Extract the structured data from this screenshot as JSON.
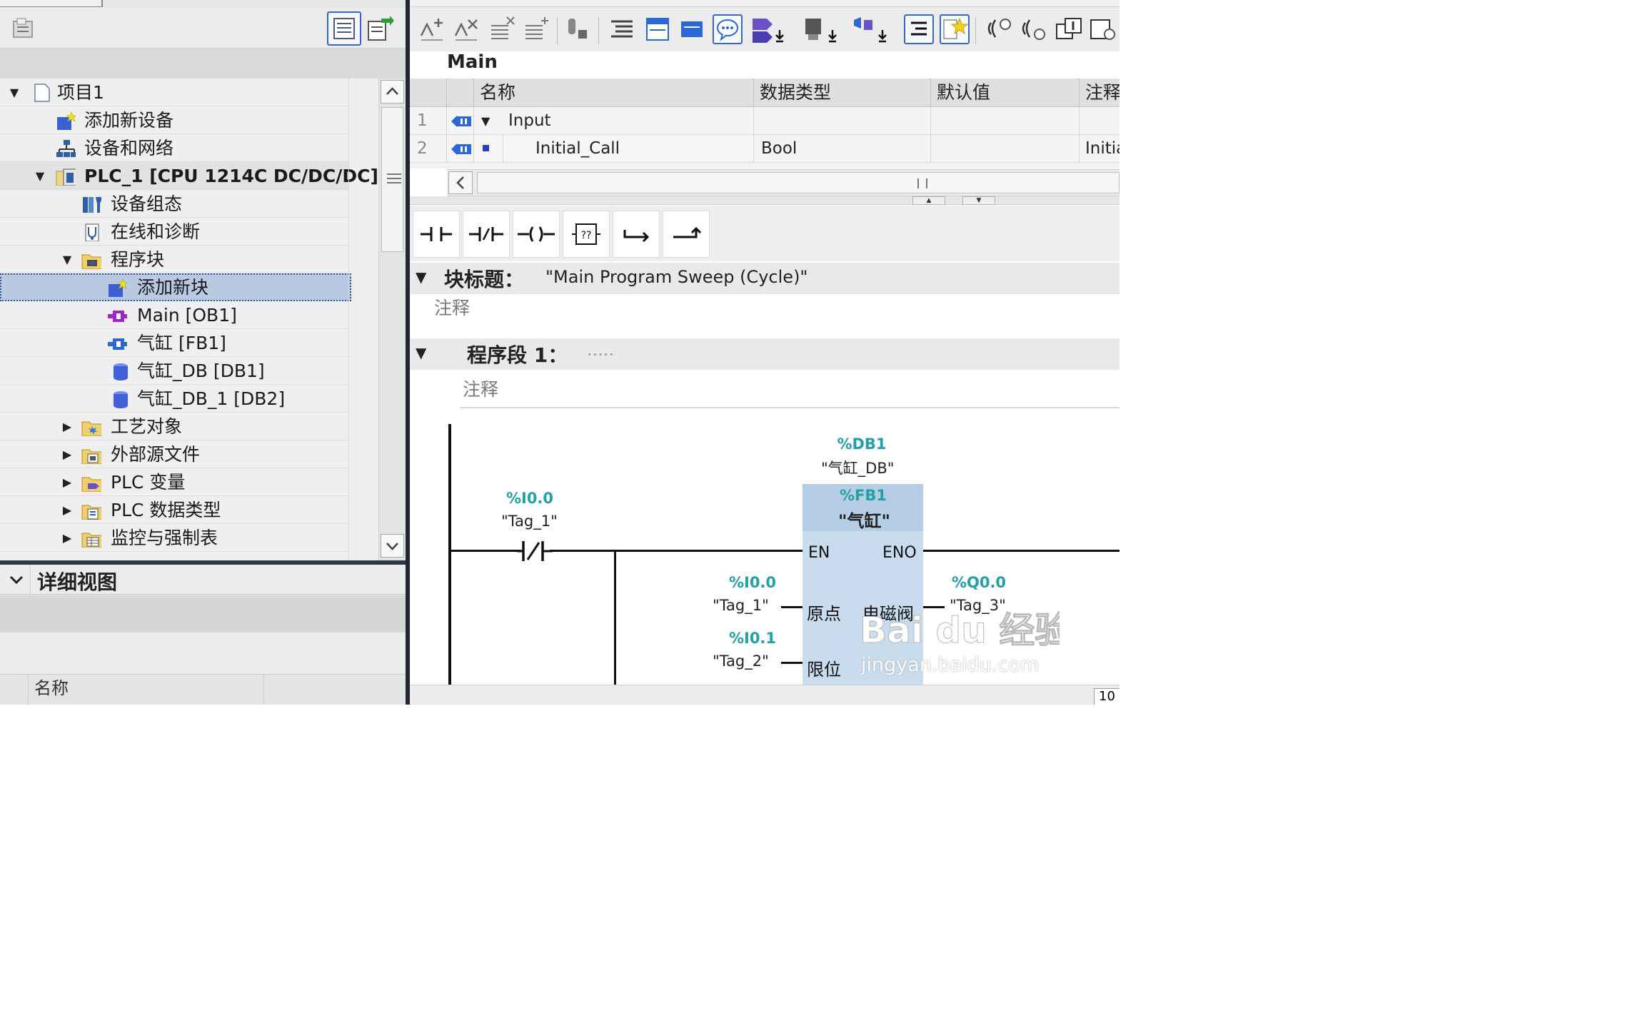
{
  "project_tree": {
    "items": [
      {
        "label": "项目1",
        "icon": "project-icon",
        "expanded": true
      },
      {
        "label": "添加新设备",
        "icon": "add-device-icon"
      },
      {
        "label": "设备和网络",
        "icon": "network-icon"
      },
      {
        "label": "PLC_1 [CPU 1214C DC/DC/DC]",
        "icon": "plc-icon",
        "expanded": true
      },
      {
        "label": "设备组态",
        "icon": "device-config-icon"
      },
      {
        "label": "在线和诊断",
        "icon": "diagnostics-icon"
      },
      {
        "label": "程序块",
        "icon": "folder-icon",
        "expanded": true
      },
      {
        "label": "添加新块",
        "icon": "add-block-icon",
        "selected": true
      },
      {
        "label": "Main [OB1]",
        "icon": "ob-block-icon"
      },
      {
        "label": "气缸 [FB1]",
        "icon": "fb-block-icon"
      },
      {
        "label": "气缸_DB [DB1]",
        "icon": "db-icon"
      },
      {
        "label": "气缸_DB_1 [DB2]",
        "icon": "db-icon"
      },
      {
        "label": "工艺对象",
        "icon": "folder-icon",
        "expanded": false
      },
      {
        "label": "外部源文件",
        "icon": "folder-icon",
        "expanded": false
      },
      {
        "label": "PLC 变量",
        "icon": "folder-icon",
        "expanded": false
      },
      {
        "label": "PLC 数据类型",
        "icon": "folder-icon",
        "expanded": false
      },
      {
        "label": "监控与强制表",
        "icon": "folder-icon",
        "expanded": false
      }
    ]
  },
  "detail_view": {
    "title": "详细视图",
    "column_name": "名称"
  },
  "editor": {
    "block_name": "Main",
    "interface": {
      "headers": [
        "名称",
        "数据类型",
        "默认值",
        "注释"
      ],
      "rows": [
        {
          "num": "1",
          "name": "Input",
          "type": "",
          "default": "",
          "comment": ""
        },
        {
          "num": "2",
          "name": "Initial_Call",
          "type": "Bool",
          "default": "",
          "comment": "Initia"
        }
      ]
    },
    "block_title_label": "块标题：",
    "block_title_value": "\"Main Program Sweep (Cycle)\"",
    "block_comment": "注释",
    "network_label": "程序段 1：",
    "network_dots": ".....",
    "network_comment": "注释",
    "zoom": "10"
  },
  "ladder": {
    "contact_addr": "%I0.0",
    "contact_tag": "\"Tag_1\"",
    "instance_db_addr": "%DB1",
    "instance_db_name": "\"气缸_DB\"",
    "fb_addr": "%FB1",
    "fb_name": "\"气缸\"",
    "pin_en": "EN",
    "pin_eno": "ENO",
    "in1_addr": "%I0.0",
    "in1_tag": "\"Tag_1\"",
    "in1_pin": "原点",
    "in2_addr": "%I0.1",
    "in2_tag": "\"Tag_2\"",
    "in2_pin": "限位",
    "out1_pin": "电磁阀",
    "out1_addr": "%Q0.0",
    "out1_tag": "\"Tag_3\""
  },
  "watermark": {
    "brand": "Bai du 经验",
    "url": "jingyan.baidu.com"
  },
  "colors": {
    "address_teal": "#21a0a8",
    "fb_box": "#c9dcee",
    "selection": "#b8c9e1"
  }
}
